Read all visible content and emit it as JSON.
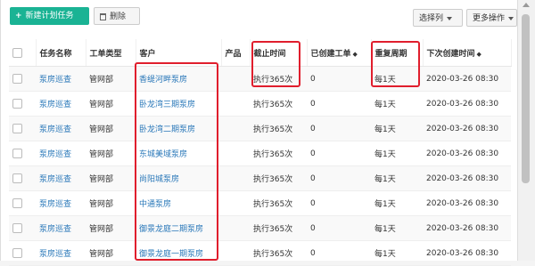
{
  "toolbar": {
    "new_task_label": "新建计划任务",
    "delete_label": "删除",
    "select_columns_label": "选择列",
    "more_actions_label": "更多操作"
  },
  "table": {
    "headers": [
      "任务名称",
      "工单类型",
      "客户",
      "产品",
      "截止时间",
      "已创建工单",
      "重复周期",
      "下次创建时间"
    ],
    "rows": [
      [
        "泵房巡查",
        "管网部",
        "香缇河畔泵房",
        "",
        "执行365次",
        "0",
        "每1天",
        "2020-03-26 08:30"
      ],
      [
        "泵房巡查",
        "管网部",
        "卧龙湾三期泵房",
        "",
        "执行365次",
        "0",
        "每1天",
        "2020-03-26 08:30"
      ],
      [
        "泵房巡查",
        "管网部",
        "卧龙湾二期泵房",
        "",
        "执行365次",
        "0",
        "每1天",
        "2020-03-26 08:30"
      ],
      [
        "泵房巡查",
        "管网部",
        "东城美域泵房",
        "",
        "执行365次",
        "0",
        "每1天",
        "2020-03-26 08:30"
      ],
      [
        "泵房巡查",
        "管网部",
        "尚阳城泵房",
        "",
        "执行365次",
        "0",
        "每1天",
        "2020-03-26 08:30"
      ],
      [
        "泵房巡查",
        "管网部",
        "中通泵房",
        "",
        "执行365次",
        "0",
        "每1天",
        "2020-03-26 08:30"
      ],
      [
        "泵房巡查",
        "管网部",
        "御景龙庭二期泵房",
        "",
        "执行365次",
        "0",
        "每1天",
        "2020-03-26 08:30"
      ],
      [
        "泵房巡查",
        "管网部",
        "御景龙庭一期泵房",
        "",
        "执行365次",
        "0",
        "每1天",
        "2020-03-26 08:30"
      ]
    ]
  },
  "colors": {
    "primary": "#1ab394",
    "link": "#2a78b9",
    "highlight": "#e01e2d"
  },
  "icons": {
    "add": "plus-icon",
    "delete": "trash-icon",
    "dropdown": "caret-down-icon",
    "sort": "sort-icon"
  }
}
